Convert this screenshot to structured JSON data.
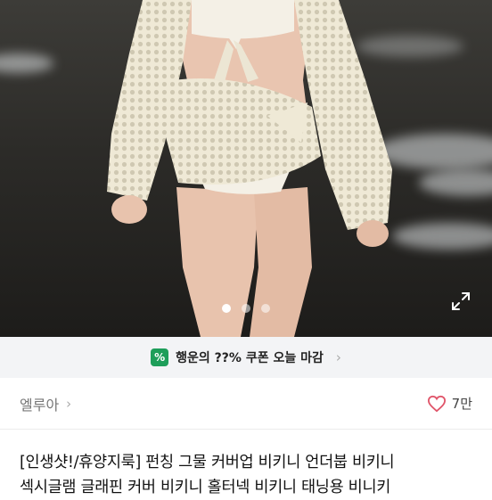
{
  "gallery": {
    "image_alt": "",
    "total_images": 3,
    "active_index": 0
  },
  "coupon": {
    "icon_symbol": "%",
    "text": "행운의 ??% 쿠폰 오늘 마감",
    "accent_color": "#1e9e5a"
  },
  "seller": {
    "name": "엘루아"
  },
  "likes": {
    "count": "7만",
    "heart_color": "#e0556a"
  },
  "product": {
    "title_line1": "[인생샷!/휴양지룩] 펀칭 그물 커버업 비키니 언더붑 비키니",
    "title_line2": "섹시글램 글래핀 커버 비키니 홀터넥 비키니 태닝용 비니키"
  }
}
